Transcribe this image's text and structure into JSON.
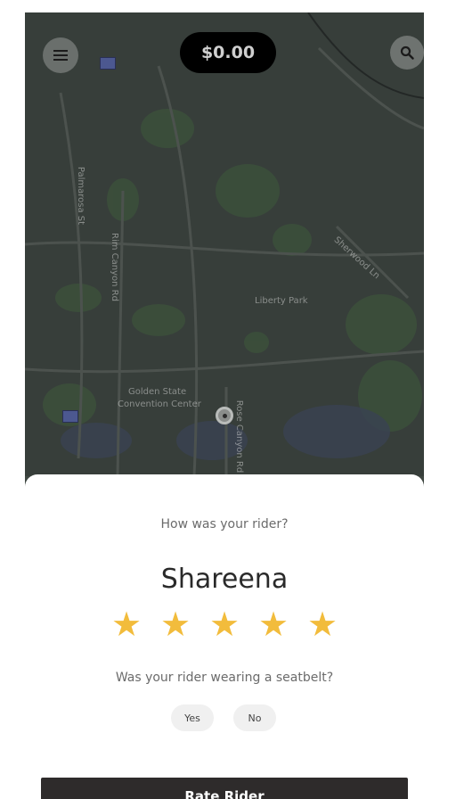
{
  "app": {
    "earnings": "$0.00"
  },
  "map": {
    "labels": [
      "Palmarosa St",
      "Rim Canyon Rd",
      "Rose Canyon Rd",
      "Sherwood Ln",
      "Liberty Park"
    ],
    "poi_label_line1": "Golden State",
    "poi_label_line2": "Convention Center"
  },
  "rating": {
    "prompt": "How was your rider?",
    "rider_name": "Shareena",
    "stars": 5,
    "star_glyph": "★",
    "star_color": "#f2bc3c",
    "seatbelt_question": "Was your rider wearing a seatbelt?",
    "yes_label": "Yes",
    "no_label": "No",
    "submit_label": "Rate Rider"
  }
}
